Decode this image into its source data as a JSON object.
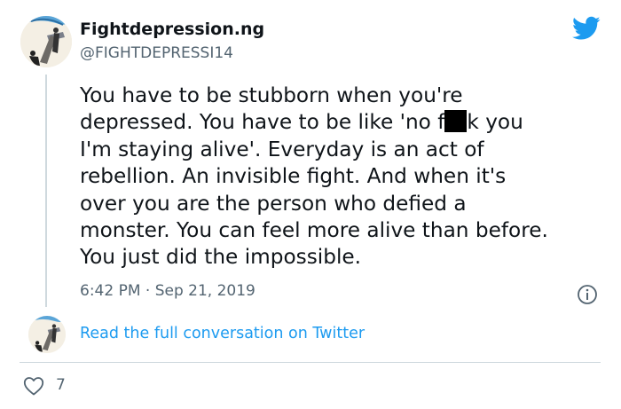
{
  "tweet": {
    "display_name": "Fightdepression.ng",
    "handle": "@FIGHTDEPRESSI14",
    "text_lines": [
      "You have to be stubborn when you're",
      "depressed. You have to be like 'no f",
      "k you",
      "I'm staying alive'. Everyday is an act of",
      "rebellion. An invisible fight. And when it's",
      "over you are the person who defied a",
      "monster. You can feel  more alive than before.",
      "You just did the impossible."
    ],
    "timestamp": "6:42 PM · Sep 21, 2019"
  },
  "icons": {
    "brand": "twitter-bird-icon",
    "info": "info-icon",
    "like": "heart-icon"
  },
  "colors": {
    "twitter_blue": "#1d9bf0",
    "text": "#0f1419",
    "secondary": "#536471",
    "line": "#cfd9de"
  },
  "footer": {
    "read_link": "Read the full conversation on Twitter",
    "like_count": "7"
  }
}
